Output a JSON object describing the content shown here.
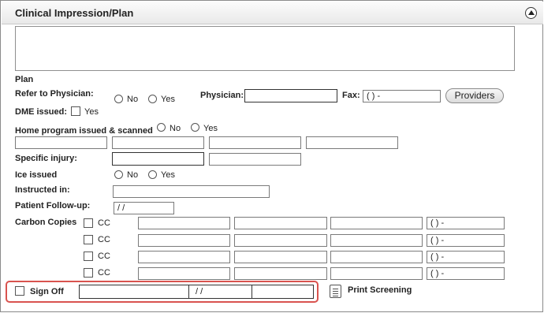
{
  "panel": {
    "title": "Clinical Impression/Plan"
  },
  "plan": {
    "heading": "Plan",
    "refer": {
      "label": "Refer to Physician:",
      "opt_no": "No",
      "opt_yes": "Yes"
    },
    "physician": {
      "label": "Physician:",
      "value": ""
    },
    "fax": {
      "label": "Fax:",
      "value": "(   )    -"
    },
    "providers_button": "Providers",
    "dme": {
      "label": "DME issued:",
      "opt_yes": "Yes"
    },
    "home_program": {
      "label": "Home program issued & scanned",
      "opt_no": "No",
      "opt_yes": "Yes"
    },
    "specific_injury": {
      "label": "Specific injury:"
    },
    "ice": {
      "label": "Ice issued",
      "opt_no": "No",
      "opt_yes": "Yes"
    },
    "instructed": {
      "label": "Instructed in:"
    },
    "followup": {
      "label": "Patient Follow-up:",
      "value": "  /  /"
    },
    "carbon_copies": {
      "label": "Carbon Copies",
      "rows": [
        {
          "cc": "CC",
          "phone": "(   )    -"
        },
        {
          "cc": "CC",
          "phone": "(   )    -"
        },
        {
          "cc": "CC",
          "phone": "(   )    -"
        },
        {
          "cc": "CC",
          "phone": "(   )    -"
        }
      ]
    }
  },
  "signoff": {
    "label": "Sign Off",
    "date": "  /  /"
  },
  "print_screening": "Print Screening",
  "icons": {
    "collapse": "chevron-up-circle-icon",
    "print": "document-icon"
  },
  "colors": {
    "highlight": "#d9534f"
  }
}
